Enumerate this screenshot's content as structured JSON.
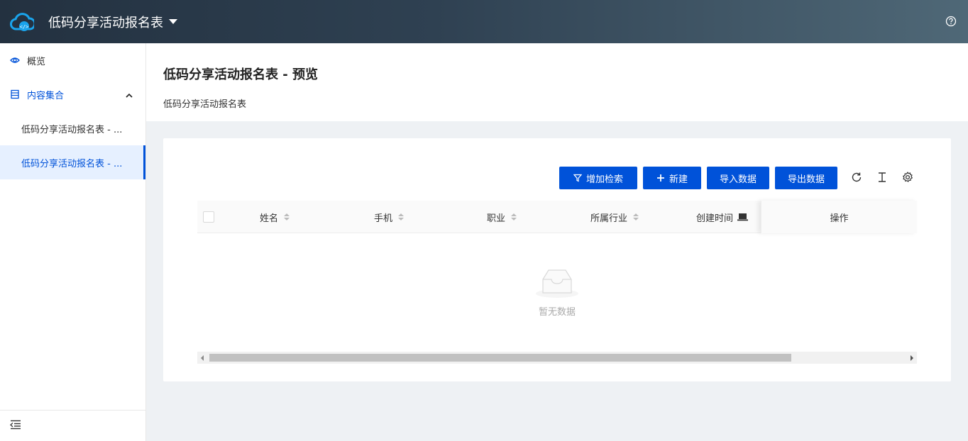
{
  "header": {
    "app_title": "低码分享活动报名表"
  },
  "sidebar": {
    "overview": "概览",
    "content_group": "内容集合",
    "items": [
      {
        "label": "低码分享活动报名表 - ..."
      },
      {
        "label": "低码分享活动报名表 - ..."
      }
    ]
  },
  "page": {
    "title": "低码分享活动报名表 - 预览",
    "description": "低码分享活动报名表"
  },
  "toolbar": {
    "add_filter": "增加检索",
    "new": "新建",
    "import": "导入数据",
    "export": "导出数据"
  },
  "table": {
    "columns": [
      "姓名",
      "手机",
      "职业",
      "所属行业",
      "创建时间"
    ],
    "actions_header": "操作",
    "empty_text": "暂无数据"
  },
  "colors": {
    "primary": "#0052d9",
    "header_start": "#233140",
    "header_end": "#4f6877"
  }
}
